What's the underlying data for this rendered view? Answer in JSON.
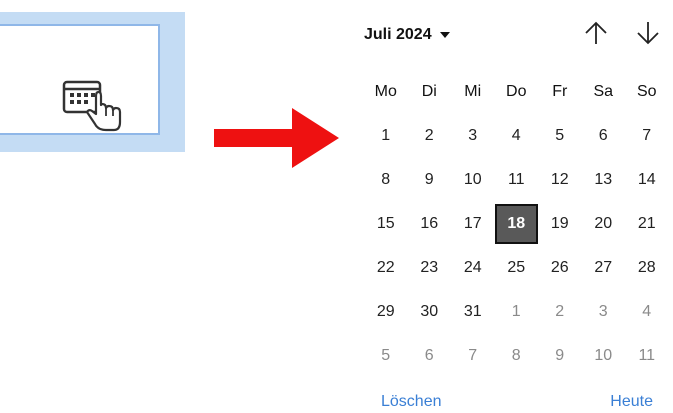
{
  "illustration": {
    "icon": "calendar-click-icon"
  },
  "arrow": {
    "color": "#ee1111"
  },
  "calendar": {
    "month_label": "Juli 2024",
    "weekdays": [
      "Mo",
      "Di",
      "Mi",
      "Do",
      "Fr",
      "Sa",
      "So"
    ],
    "weeks": [
      [
        {
          "d": "1"
        },
        {
          "d": "2"
        },
        {
          "d": "3"
        },
        {
          "d": "4"
        },
        {
          "d": "5"
        },
        {
          "d": "6"
        },
        {
          "d": "7"
        }
      ],
      [
        {
          "d": "8"
        },
        {
          "d": "9"
        },
        {
          "d": "10"
        },
        {
          "d": "11"
        },
        {
          "d": "12"
        },
        {
          "d": "13"
        },
        {
          "d": "14"
        }
      ],
      [
        {
          "d": "15"
        },
        {
          "d": "16"
        },
        {
          "d": "17"
        },
        {
          "d": "18",
          "today": true
        },
        {
          "d": "19"
        },
        {
          "d": "20"
        },
        {
          "d": "21"
        }
      ],
      [
        {
          "d": "22"
        },
        {
          "d": "23"
        },
        {
          "d": "24"
        },
        {
          "d": "25"
        },
        {
          "d": "26"
        },
        {
          "d": "27"
        },
        {
          "d": "28"
        }
      ],
      [
        {
          "d": "29"
        },
        {
          "d": "30"
        },
        {
          "d": "31"
        },
        {
          "d": "1",
          "other": true
        },
        {
          "d": "2",
          "other": true
        },
        {
          "d": "3",
          "other": true
        },
        {
          "d": "4",
          "other": true
        }
      ],
      [
        {
          "d": "5",
          "other": true
        },
        {
          "d": "6",
          "other": true
        },
        {
          "d": "7",
          "other": true
        },
        {
          "d": "8",
          "other": true
        },
        {
          "d": "9",
          "other": true
        },
        {
          "d": "10",
          "other": true
        },
        {
          "d": "11",
          "other": true
        }
      ]
    ],
    "clear_label": "Löschen",
    "today_label": "Heute",
    "prev_icon": "arrow-up-icon",
    "next_icon": "arrow-down-icon",
    "accent_color": "#3a7fd5",
    "selected_bg": "#595959"
  }
}
